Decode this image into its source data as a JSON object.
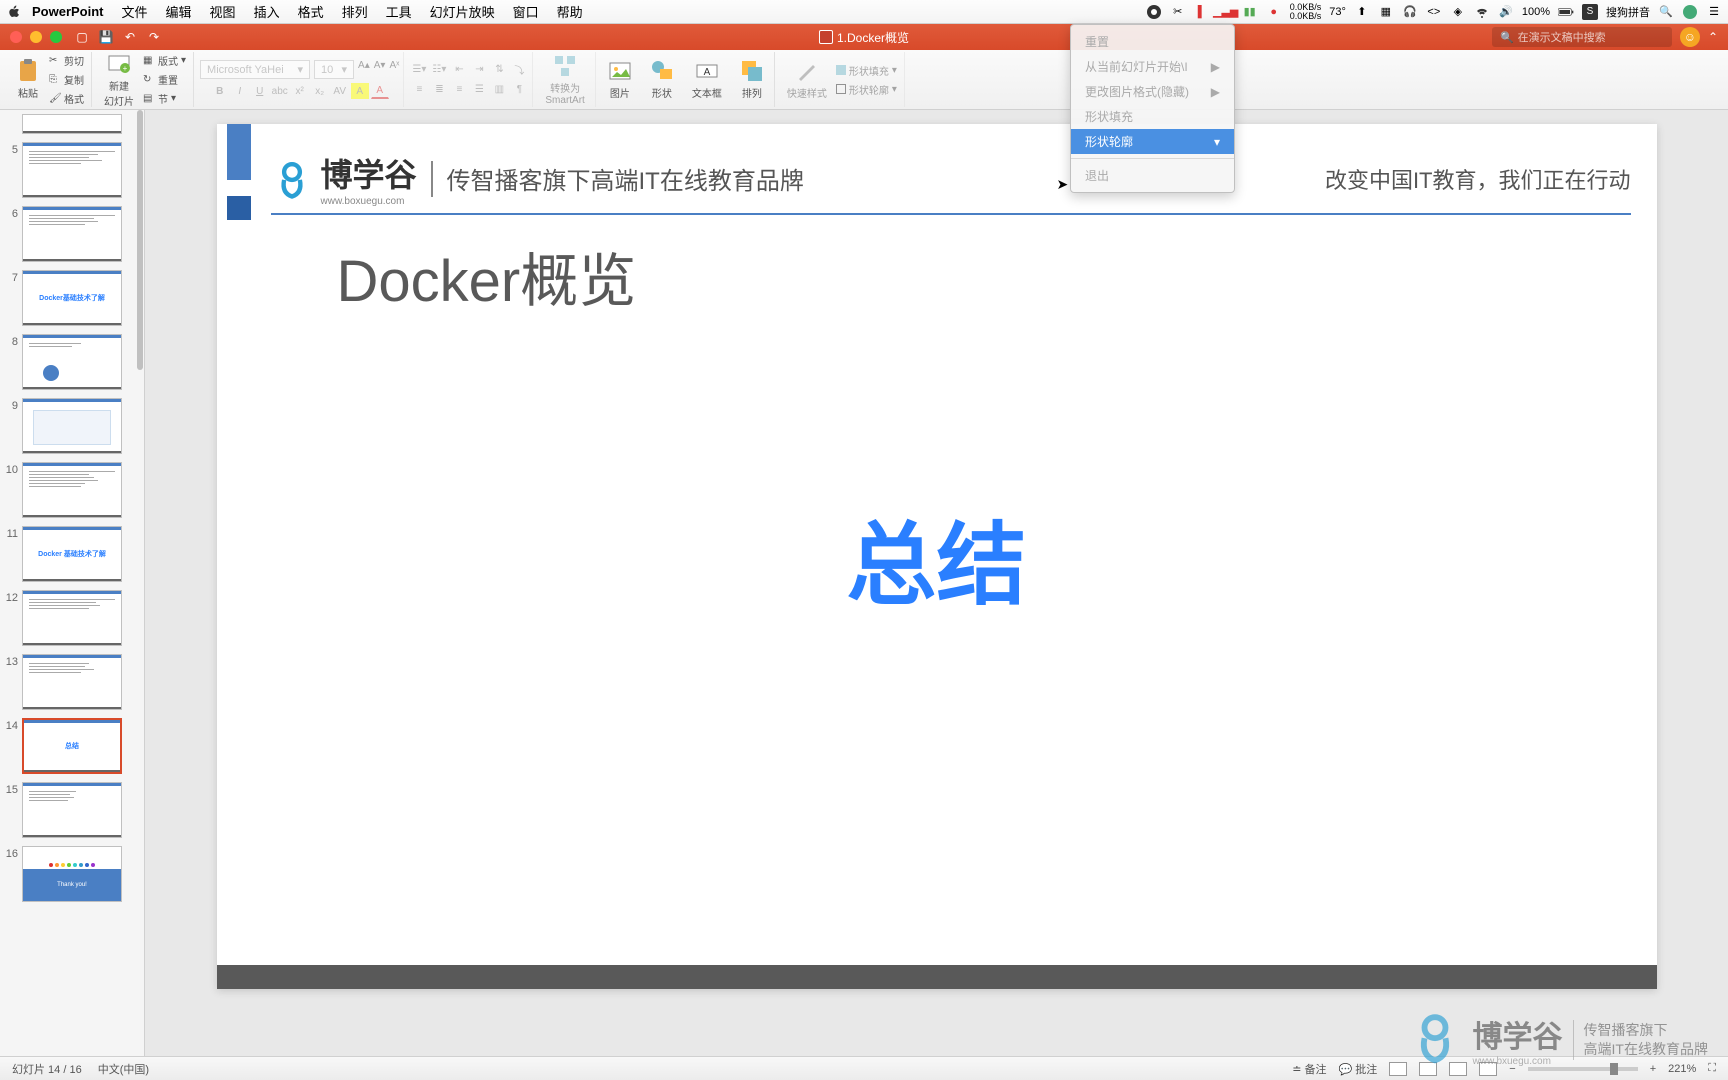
{
  "menubar": {
    "app": "PowerPoint",
    "items": [
      "文件",
      "编辑",
      "视图",
      "插入",
      "格式",
      "排列",
      "工具",
      "幻灯片放映",
      "窗口",
      "帮助"
    ],
    "right": {
      "net_up": "0.0KB/s",
      "net_down": "0.0KB/s",
      "temp": "73°",
      "battery": "100%",
      "ime": "搜狗拼音"
    }
  },
  "titlebar": {
    "doc": "1.Docker概览",
    "search_placeholder": "在演示文稿中搜索"
  },
  "ribbon": {
    "paste": "粘贴",
    "cut": "剪切",
    "copy": "复制",
    "format": "格式",
    "new_slide": "新建\n幻灯片",
    "layout": "版式",
    "reset": "重置",
    "section": "节",
    "font_name": "Microsoft YaHei",
    "font_size": "10",
    "convert_smartart": "转换为\nSmartArt",
    "picture": "图片",
    "shape": "形状",
    "textbox": "文本框",
    "arrange": "排列",
    "quickstyle": "快速样式",
    "shape_fill": "形状填充",
    "shape_outline": "形状轮廓"
  },
  "context_menu": {
    "item1": "重置",
    "item2": "从当前幻灯片开始\\I",
    "item3": "更改图片格式(隐藏)",
    "item4": "形状填充",
    "item5": "形状轮廓",
    "item6": "退出"
  },
  "thumbnails": {
    "start": 5,
    "count": 12,
    "slide7_text": "Docker基础技术了解",
    "slide11_text": "Docker 基础技术了解",
    "slide14_text": "总结",
    "slide16_text": "Thank you!"
  },
  "slide": {
    "brand": "博学谷",
    "brand_url": "www.boxuegu.com",
    "tagline": "传智播客旗下高端IT在线教育品牌",
    "right_tag": "改变中国IT教育，我们正在行动",
    "title": "Docker概览",
    "center": "总结"
  },
  "watermark": {
    "brand": "博学谷",
    "url": "www.bxuegu.com",
    "tag1": "传智播客旗下",
    "tag2": "高端IT在线教育品牌"
  },
  "statusbar": {
    "slide_info": "幻灯片 14 / 16",
    "lang": "中文(中国)",
    "notes": "备注",
    "comments": "批注",
    "zoom": "221%"
  }
}
